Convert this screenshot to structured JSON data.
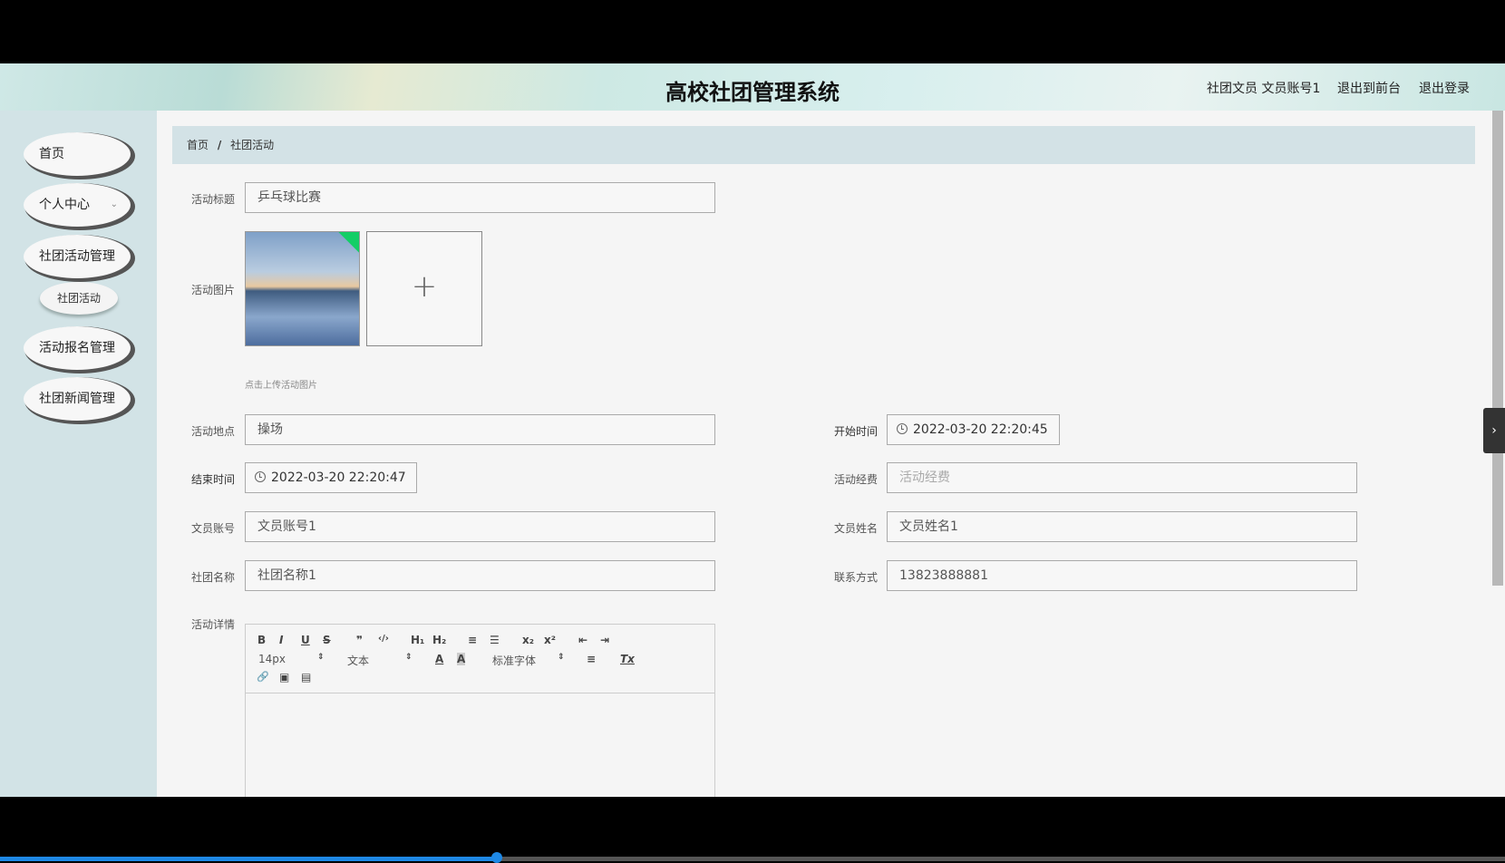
{
  "header": {
    "title": "高校社团管理系统",
    "user": "社团文员 文员账号1",
    "front": "退出到前台",
    "logout": "退出登录"
  },
  "sidebar": {
    "items": [
      {
        "label": "首页"
      },
      {
        "label": "个人中心",
        "chev": "⌄"
      },
      {
        "label": "社团活动管理"
      },
      {
        "label": "社团活动"
      },
      {
        "label": "活动报名管理"
      },
      {
        "label": "社团新闻管理"
      }
    ]
  },
  "breadcrumb": {
    "home": "首页",
    "sep": "/",
    "current": "社团活动"
  },
  "form": {
    "title": {
      "label": "活动标题",
      "value": "乒乓球比赛"
    },
    "image": {
      "label": "活动图片",
      "hint": "点击上传活动图片",
      "plus": "+"
    },
    "place": {
      "label": "活动地点",
      "value": "操场"
    },
    "start": {
      "label": "开始时间",
      "value": "2022-03-20 22:20:45"
    },
    "end": {
      "label": "结束时间",
      "value": "2022-03-20 22:20:47"
    },
    "fee": {
      "label": "活动经费",
      "placeholder": "活动经费"
    },
    "account": {
      "label": "文员账号",
      "value": "文员账号1"
    },
    "name": {
      "label": "文员姓名",
      "value": "文员姓名1"
    },
    "club": {
      "label": "社团名称",
      "value": "社团名称1"
    },
    "phone": {
      "label": "联系方式",
      "value": "13823888881"
    },
    "detail": {
      "label": "活动详情"
    }
  },
  "editor": {
    "size": "14px",
    "header": "文本",
    "font": "标准字体",
    "buttons": [
      "B",
      "I",
      "U",
      "S",
      "❞",
      "‹/›",
      "H₁",
      "H₂",
      "≡",
      "☰",
      "x₂",
      "x²",
      "⇤",
      "⇥"
    ],
    "row2": [
      "A",
      "A",
      "≡",
      "Tx"
    ],
    "row3": [
      "🔗",
      "▣",
      "▤"
    ]
  },
  "toggle": "›",
  "video_progress": 0.33
}
